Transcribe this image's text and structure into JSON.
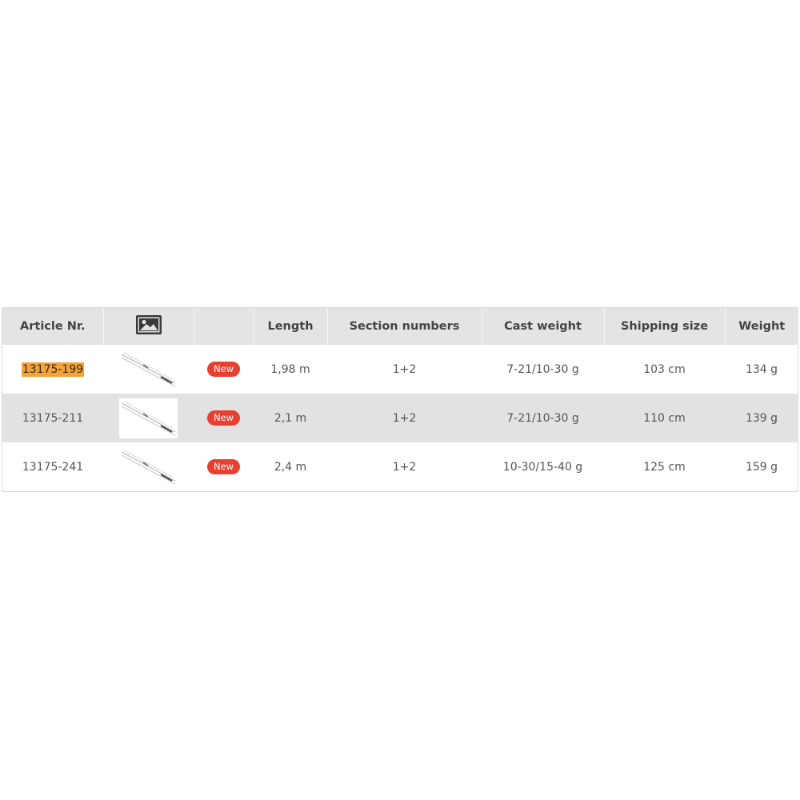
{
  "table": {
    "headers": {
      "article": "Article Nr.",
      "image_icon": "image-icon",
      "badge": "",
      "length": "Length",
      "sections": "Section numbers",
      "cast_weight": "Cast weight",
      "shipping_size": "Shipping size",
      "weight": "Weight"
    },
    "rows": [
      {
        "article": "13175-199",
        "highlighted": true,
        "badge": "New",
        "length": "1,98 m",
        "sections": "1+2",
        "cast_weight": "7-21/10-30 g",
        "shipping_size": "103 cm",
        "weight": "134 g"
      },
      {
        "article": "13175-211",
        "highlighted": false,
        "badge": "New",
        "length": "2,1 m",
        "sections": "1+2",
        "cast_weight": "7-21/10-30 g",
        "shipping_size": "110 cm",
        "weight": "139 g"
      },
      {
        "article": "13175-241",
        "highlighted": false,
        "badge": "New",
        "length": "2,4 m",
        "sections": "1+2",
        "cast_weight": "10-30/15-40 g",
        "shipping_size": "125 cm",
        "weight": "159 g"
      }
    ]
  },
  "colors": {
    "header_bg": "#e4e4e4",
    "alt_row_bg": "#e2e2e2",
    "highlight": "#f5a23a",
    "badge_bg": "#e8402f"
  }
}
